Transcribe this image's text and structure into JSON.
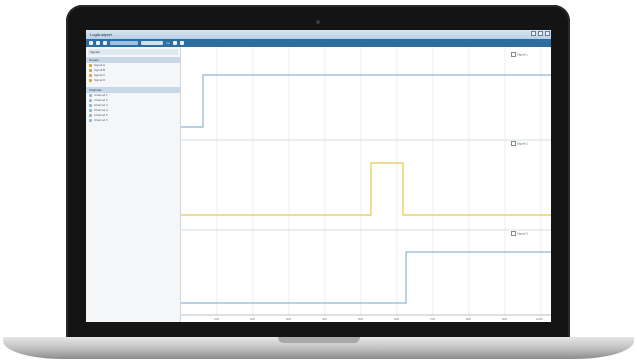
{
  "window": {
    "title": "LogAnalyser"
  },
  "toolbar": {
    "search_text": "search",
    "field_text": "zoom",
    "unit_text": "ms"
  },
  "sidebar": {
    "header": "Signals",
    "sections": [
      {
        "label": "Groups",
        "items": [
          {
            "label": "Signal A"
          },
          {
            "label": "Signal B"
          },
          {
            "label": "Signal C"
          },
          {
            "label": "Signal D"
          }
        ]
      },
      {
        "label": "Channels",
        "items": [
          {
            "label": "Channel 1"
          },
          {
            "label": "Channel 2"
          },
          {
            "label": "Channel 3"
          },
          {
            "label": "Channel 4"
          },
          {
            "label": "Channel 5"
          },
          {
            "label": "Channel 6"
          }
        ]
      }
    ]
  },
  "plot": {
    "series": [
      {
        "label": "Signal 1",
        "color": "#8fb6cf"
      },
      {
        "label": "Signal 2",
        "color": "#e8c84a"
      },
      {
        "label": "Signal 3",
        "color": "#8fb6cf"
      }
    ],
    "x_ticks": [
      "100",
      "200",
      "300",
      "400",
      "500",
      "600",
      "700",
      "800",
      "900",
      "1000"
    ]
  }
}
